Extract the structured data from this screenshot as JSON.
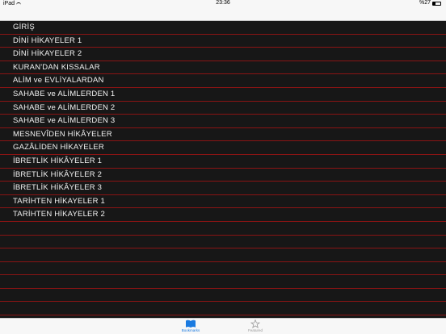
{
  "status_bar": {
    "carrier": "iPad",
    "time": "23:36",
    "battery": "%27"
  },
  "list": {
    "items": [
      "GİRİŞ",
      "DİNİ HİKAYELER 1",
      "DİNİ HİKAYELER 2",
      "KURAN'DAN KISSALAR",
      "ALİM ve EVLİYALARDAN",
      "SAHABE ve ALİMLERDEN 1",
      "SAHABE ve ALİMLERDEN 2",
      "SAHABE ve ALİMLERDEN 3",
      "MESNEVÎDEN HİKÂYELER",
      "GAZÂLİDEN HİKAYELER",
      "İBRETLİK HİKÂYELER 1",
      "İBRETLİK HİKÂYELER 2",
      "İBRETLİK HİKÂYELER 3",
      "TARİHTEN HİKAYELER 1",
      "TARİHTEN HİKAYELER 2"
    ],
    "empty_row_count": 7
  },
  "tab_bar": {
    "tabs": [
      {
        "label": "Bookmarks",
        "icon": "book-icon",
        "selected": true
      },
      {
        "label": "Featured",
        "icon": "star-icon",
        "selected": false
      }
    ]
  },
  "colors": {
    "list_background": "#171717",
    "row_separator": "#8a1414",
    "row_text": "#f2f2f2",
    "tab_active": "#1a7ae0",
    "tab_inactive": "#9a9a9a"
  }
}
